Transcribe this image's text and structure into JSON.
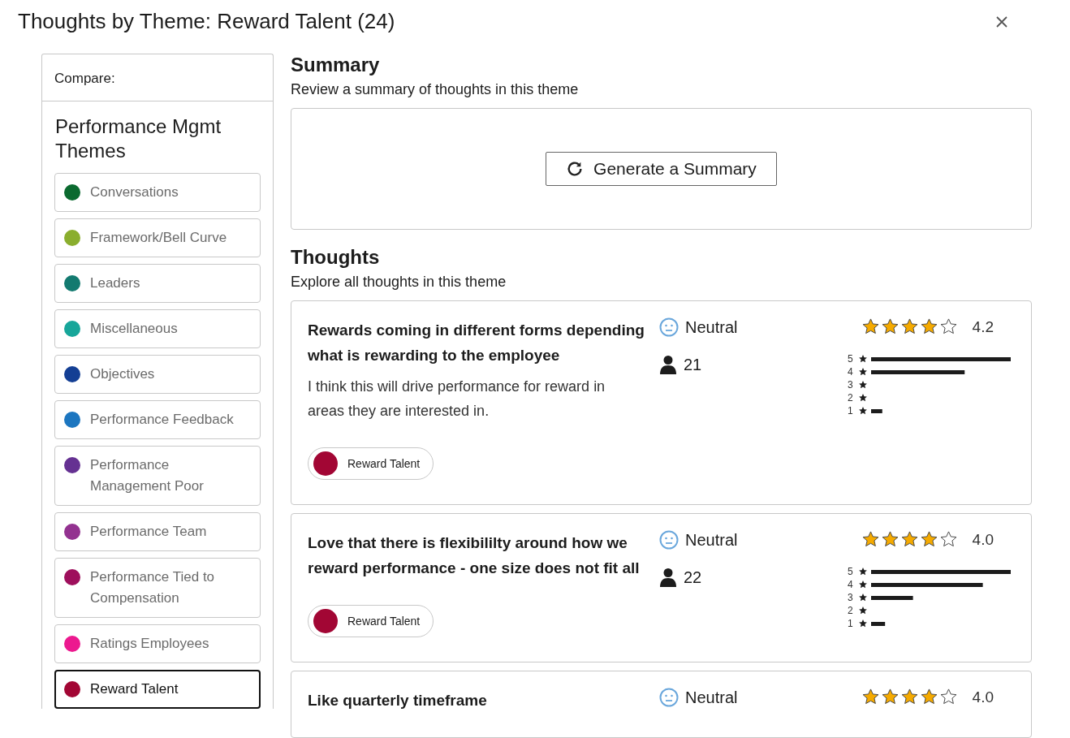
{
  "window": {
    "title": "Thoughts by Theme: Reward Talent (24)"
  },
  "sidebar": {
    "compare_label": "Compare:",
    "heading": "Performance Mgmt Themes",
    "items": [
      {
        "label": "Conversations",
        "color": "#0b6a2f",
        "selected": false
      },
      {
        "label": "Framework/Bell Curve",
        "color": "#8aae2e",
        "selected": false
      },
      {
        "label": "Leaders",
        "color": "#137a70",
        "selected": false
      },
      {
        "label": "Miscellaneous",
        "color": "#17a69a",
        "selected": false
      },
      {
        "label": "Objectives",
        "color": "#143f94",
        "selected": false
      },
      {
        "label": "Performance Feedback",
        "color": "#1c76c0",
        "selected": false
      },
      {
        "label": "Performance Management Poor",
        "color": "#653192",
        "selected": false
      },
      {
        "label": "Performance Team",
        "color": "#933290",
        "selected": false
      },
      {
        "label": "Performance Tied to Compensation",
        "color": "#9e0f5c",
        "selected": false
      },
      {
        "label": "Ratings Employees",
        "color": "#ec198f",
        "selected": false
      },
      {
        "label": "Reward Talent",
        "color": "#a20634",
        "selected": true
      }
    ]
  },
  "summary": {
    "title": "Summary",
    "subtitle": "Review a summary of thoughts in this theme",
    "button": "Generate a Summary"
  },
  "thoughts": {
    "title": "Thoughts",
    "subtitle": "Explore all thoughts in this theme",
    "items": [
      {
        "title": "Rewards coming in different forms depending what is rewarding to the employee",
        "body": "I think this will drive performance for reward in areas they are interested in.",
        "tag": {
          "label": "Reward Talent",
          "color": "#a20634"
        },
        "sentiment": "Neutral",
        "count": "21",
        "stars": 4,
        "rating": "4.2",
        "distribution": [
          {
            "label": "5",
            "level": 1.0
          },
          {
            "label": "4",
            "level": 0.67
          },
          {
            "label": "3"
          },
          {
            "label": "2"
          },
          {
            "label": "1",
            "level": 0.08
          }
        ]
      },
      {
        "title": "Love that there is flexibililty around how we reward performance - one size does not fit all",
        "tag": {
          "label": "Reward Talent",
          "color": "#a20634"
        },
        "sentiment": "Neutral",
        "count": "22",
        "stars": 4,
        "rating": "4.0",
        "distribution": [
          {
            "label": "5",
            "level": 1.0
          },
          {
            "label": "4",
            "level": 0.8
          },
          {
            "label": "3",
            "level": 0.3
          },
          {
            "label": "2"
          },
          {
            "label": "1",
            "level": 0.1
          }
        ]
      },
      {
        "title": "Like quarterly timeframe",
        "sentiment": "Neutral",
        "stars": 4,
        "rating": "4.0"
      }
    ]
  }
}
